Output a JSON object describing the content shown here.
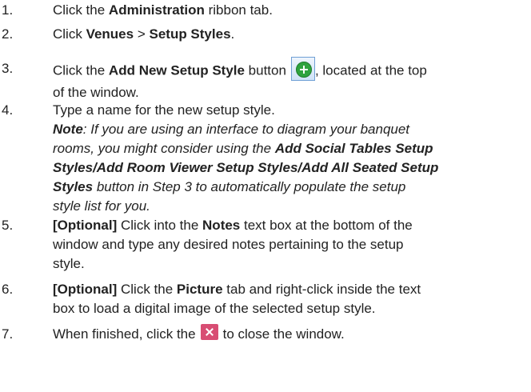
{
  "steps": [
    {
      "num": "1.",
      "pre": "Click the ",
      "bold": "Administration",
      "post": " ribbon tab."
    },
    {
      "num": "2.",
      "pre": "Click ",
      "bold1": "Venues",
      "mid": " > ",
      "bold2": "Setup Styles",
      "post": "."
    },
    {
      "num": "3.",
      "pre": "Click the ",
      "bold": "Add New Setup Style",
      "post1": " button",
      "post2": ", located at the top",
      "line2": "of the window."
    },
    {
      "num": "4.",
      "text": "Type a name for the new setup style.",
      "note_label": "Note",
      "note_l1": ": If you are using an interface to diagram your banquet",
      "note_l2": "rooms, you might consider using the ",
      "note_b1": "Add Social Tables Setup",
      "note_b2": "Styles/Add Room Viewer Setup Styles/Add All Seated Setup",
      "note_b3": "Styles",
      "note_l4": " button in Step 3 to automatically populate the setup",
      "note_l5": "style list for you."
    },
    {
      "num": "5.",
      "bold": "[Optional]",
      "pre": " Click into the ",
      "bold2": "Notes",
      "post": " text box at the bottom of the",
      "line2": "window and type any desired notes pertaining to the setup",
      "line3": "style."
    },
    {
      "num": "6.",
      "bold": "[Optional]",
      "pre": " Click the ",
      "bold2": "Picture",
      "post": " tab and right-click inside the text",
      "line2": "box to load a digital image of the selected setup style."
    },
    {
      "num": "7.",
      "pre": "When finished, click the",
      "post": "to close the window."
    }
  ],
  "icons": {
    "add": "add-new-setup-style-icon",
    "close": "close-window-icon"
  },
  "colors": {
    "add_green": "#2fa33f",
    "close_red": "#d84d73"
  }
}
